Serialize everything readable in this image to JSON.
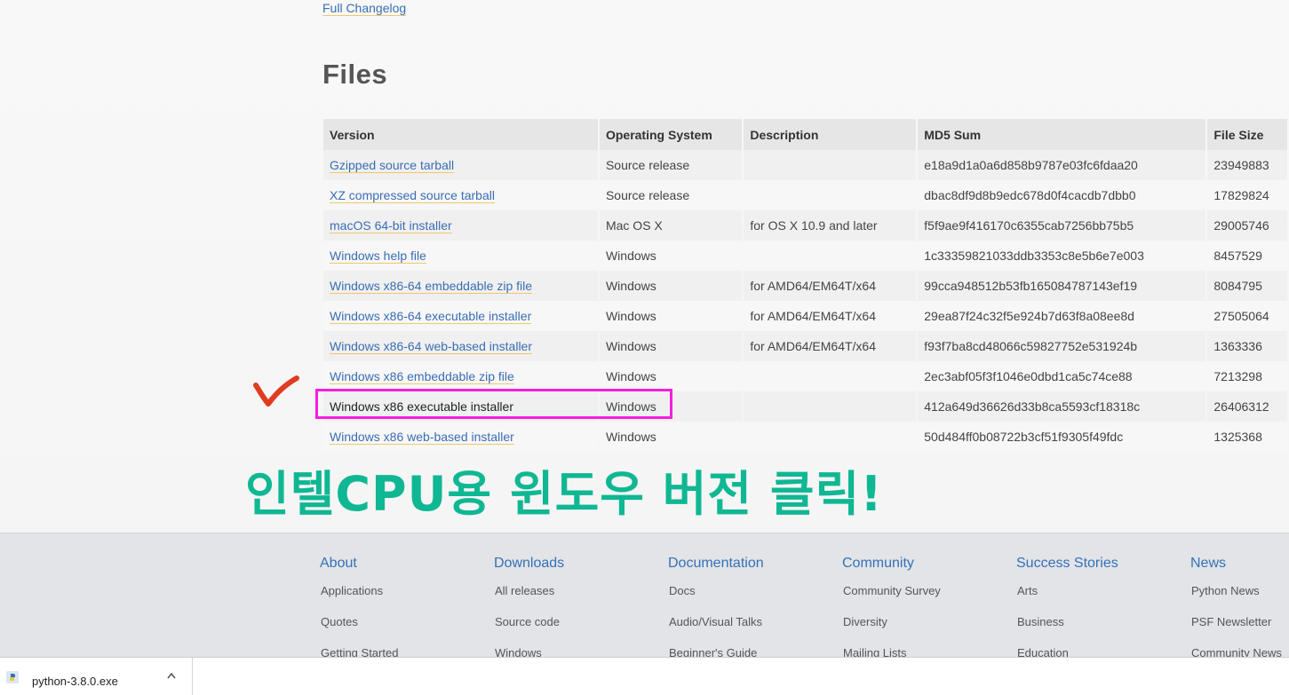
{
  "changelog": {
    "label": "Full Changelog"
  },
  "files": {
    "title": "Files",
    "headers": [
      "Version",
      "Operating System",
      "Description",
      "MD5 Sum",
      "File Size"
    ],
    "rows": [
      [
        "Gzipped source tarball",
        "Source release",
        "",
        "e18a9d1a0a6d858b9787e03fc6fdaa20",
        "23949883"
      ],
      [
        "XZ compressed source tarball",
        "Source release",
        "",
        "dbac8df9d8b9edc678d0f4cacdb7dbb0",
        "17829824"
      ],
      [
        "macOS 64-bit installer",
        "Mac OS X",
        "for OS X 10.9 and later",
        "f5f9ae9f416170c6355cab7256bb75b5",
        "29005746"
      ],
      [
        "Windows help file",
        "Windows",
        "",
        "1c33359821033ddb3353c8e5b6e7e003",
        "8457529"
      ],
      [
        "Windows x86-64 embeddable zip file",
        "Windows",
        "for AMD64/EM64T/x64",
        "99cca948512b53fb165084787143ef19",
        "8084795"
      ],
      [
        "Windows x86-64 executable installer",
        "Windows",
        "for AMD64/EM64T/x64",
        "29ea87f24c32f5e924b7d63f8a08ee8d",
        "27505064"
      ],
      [
        "Windows x86-64 web-based installer",
        "Windows",
        "for AMD64/EM64T/x64",
        "f93f7ba8cd48066c59827752e531924b",
        "1363336"
      ],
      [
        "Windows x86 embeddable zip file",
        "Windows",
        "",
        "2ec3abf05f3f1046e0dbd1ca5c74ce88",
        "7213298"
      ],
      [
        "Windows x86 executable installer",
        "Windows",
        "",
        "412a649d36626d33b8ca5593cf18318c",
        "26406312"
      ],
      [
        "Windows x86 web-based installer",
        "Windows",
        "",
        "50d484ff0b08722b3cf51f9305f49fdc",
        "1325368"
      ]
    ],
    "highlighted_row": 8
  },
  "annotation": {
    "caption": "인텔CPU용 윈도우 버전 클릭!",
    "caption_color": "#0fb793",
    "highlight_color": "#f51fdd",
    "checkmark_color": "#e03c1f"
  },
  "footer": {
    "columns": [
      {
        "heading": "About",
        "items": [
          "Applications",
          "Quotes",
          "Getting Started"
        ]
      },
      {
        "heading": "Downloads",
        "items": [
          "All releases",
          "Source code",
          "Windows"
        ]
      },
      {
        "heading": "Documentation",
        "items": [
          "Docs",
          "Audio/Visual Talks",
          "Beginner's Guide"
        ]
      },
      {
        "heading": "Community",
        "items": [
          "Community Survey",
          "Diversity",
          "Mailing Lists"
        ]
      },
      {
        "heading": "Success Stories",
        "items": [
          "Arts",
          "Business",
          "Education"
        ]
      },
      {
        "heading": "News",
        "items": [
          "Python News",
          "PSF Newsletter",
          "Community News"
        ]
      }
    ]
  },
  "download_bar": {
    "filename": "python-3.8.0.exe",
    "icon": "python-installer-icon",
    "menu_icon": "chevron-up-icon"
  },
  "colors": {
    "link": "#3a6db3",
    "link_underline": "#f1c86a",
    "footer_heading": "#3570b8"
  }
}
